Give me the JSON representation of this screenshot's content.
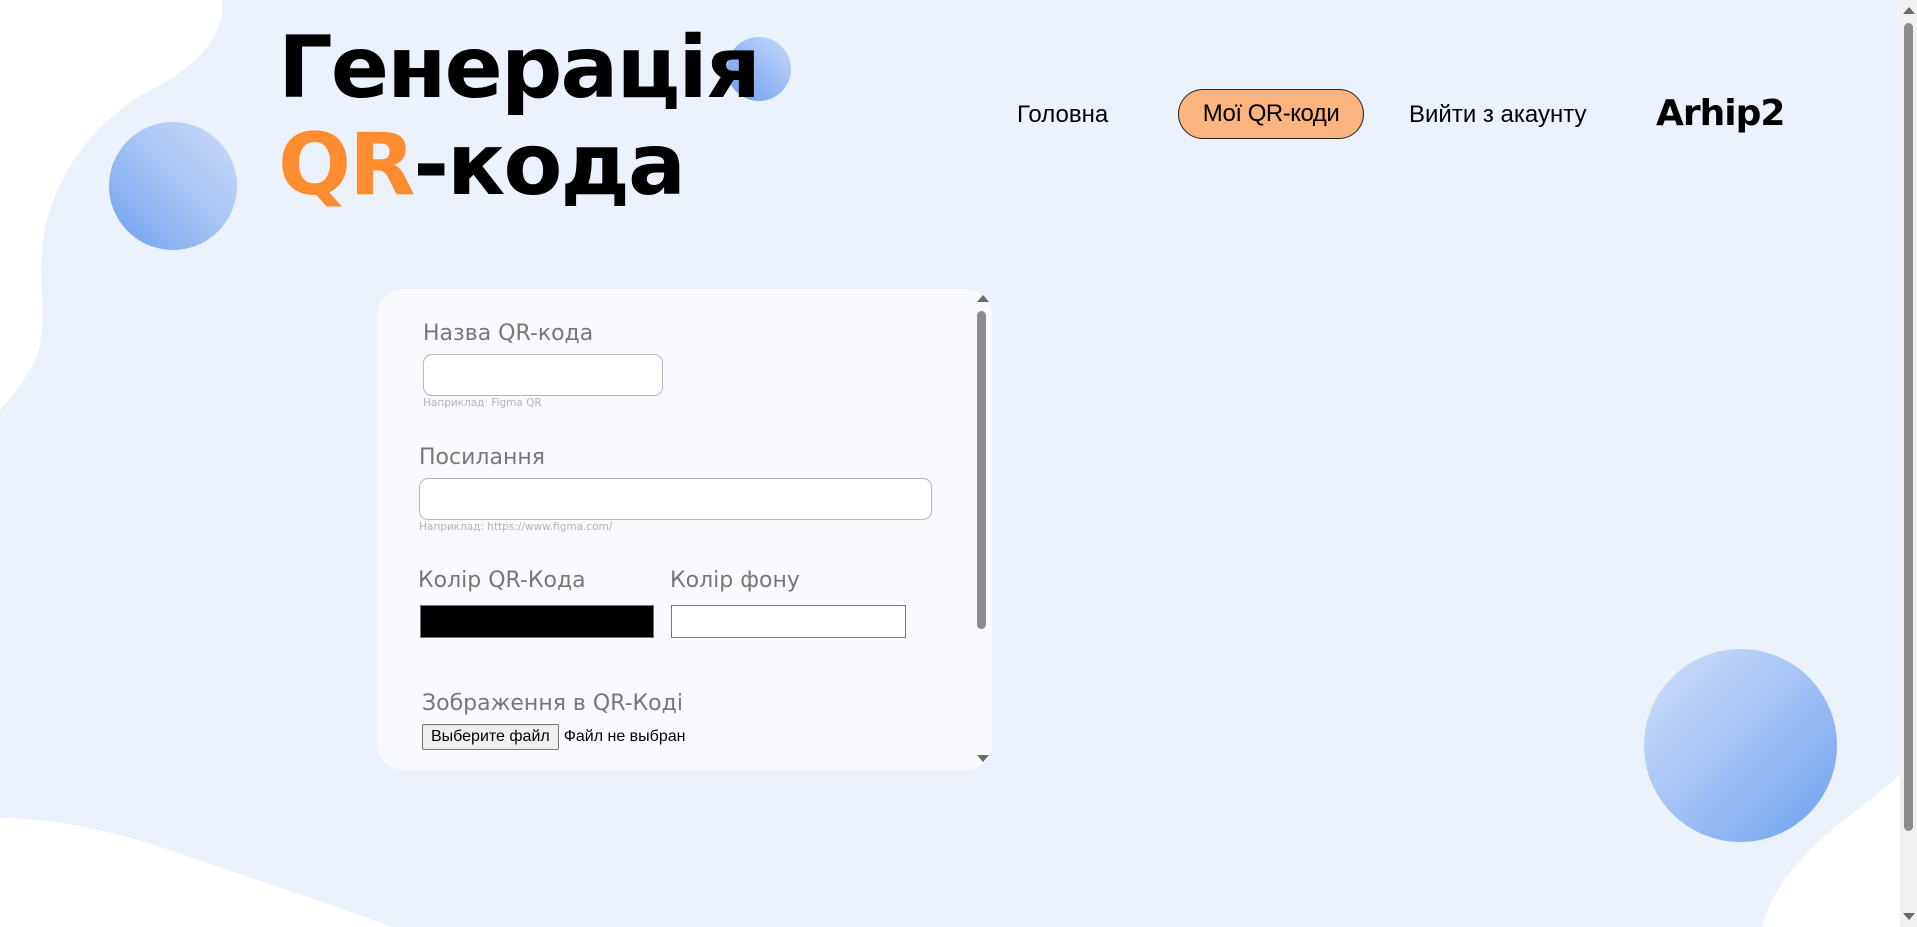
{
  "header": {
    "title_line1": "Генерація",
    "title_accent": "QR",
    "title_rest": "-кода"
  },
  "nav": {
    "home": "Головна",
    "my_codes": "Мої QR-коди",
    "logout": "Вийти з акаунту",
    "username": "Arhip2"
  },
  "form": {
    "name_label": "Назва QR-кода",
    "name_value": "",
    "name_hint": "Наприклад: Figma QR",
    "link_label": "Посилання",
    "link_value": "",
    "link_hint": "Наприклад: https://www.figma.com/",
    "qr_color_label": "Колір QR-Кода",
    "qr_color_value": "#000000",
    "bg_color_label": "Колір фону",
    "bg_color_value": "#ffffff",
    "image_label": "Зображення в QR-Коді",
    "file_button": "Выберите файл",
    "file_status": "Файл не выбран"
  },
  "colors": {
    "page_background": "#ffffff",
    "blob_background": "#ebf2fb",
    "accent_orange": "#ff8c2e",
    "active_nav_fill": "#fbb47d",
    "circle_blue": "#6e9ef0"
  }
}
